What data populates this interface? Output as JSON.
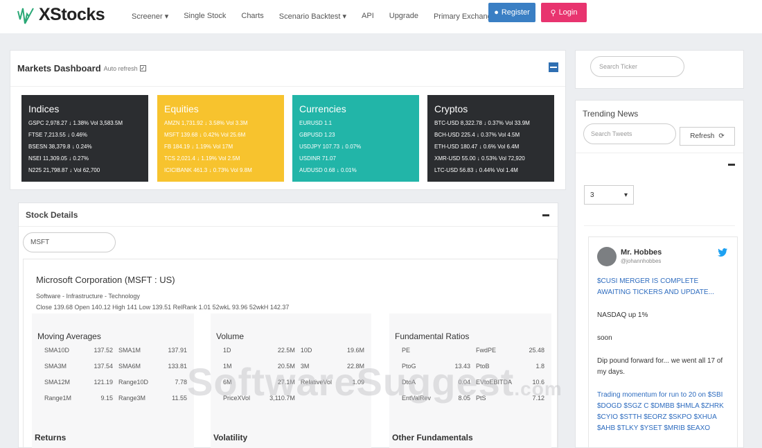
{
  "brand": {
    "name": "XStocks"
  },
  "nav": {
    "items": [
      "Screener ▾",
      "Single Stock",
      "Charts",
      "Scenario Backtest ▾",
      "API",
      "Upgrade",
      "Primary Exchange ▾ IN"
    ],
    "register_label": "Register",
    "login_label": "Login"
  },
  "markets": {
    "title": "Markets Dashboard",
    "auto_refresh_label": "Auto refresh",
    "tiles": [
      {
        "title": "Indices",
        "rows": [
          "GSPC 2,978.27 ↓ 1.38% Vol 3,583.5M",
          "FTSE 7,213.55 ↓ 0.46%",
          "BSESN 38,379.8 ↓ 0.24%",
          "NSEI 11,309.05 ↓ 0.27%",
          "N225 21,798.87 ↓ Vol 62,700"
        ]
      },
      {
        "title": "Equities",
        "rows": [
          "AMZN 1,731.92 ↓ 3.58% Vol 3.3M",
          "MSFT 139.68 ↓ 0.42% Vol 25.6M",
          "FB 184.19 ↓ 1.19% Vol 17M",
          "TCS 2,021.4 ↓ 1.19% Vol 2.5M",
          "ICICIBANK 461.3 ↓ 0.73% Vol 9.8M"
        ]
      },
      {
        "title": "Currencies",
        "rows": [
          "EURUSD 1.1",
          "GBPUSD 1.23",
          "USDJPY 107.73 ↓ 0.07%",
          "USDINR 71.07",
          "AUDUSD 0.68 ↓ 0.01%"
        ]
      },
      {
        "title": "Cryptos",
        "rows": [
          "BTC-USD 8,322.78 ↓ 0.37% Vol 33.9M",
          "BCH-USD 225.4 ↓ 0.37% Vol 4.5M",
          "ETH-USD 180.47 ↓ 0.6% Vol 6.4M",
          "XMR-USD 55.00 ↓ 0.53% Vol 72,920",
          "LTC-USD 56.83 ↓ 0.44% Vol 1.4M"
        ]
      }
    ]
  },
  "stock": {
    "title": "Stock Details",
    "ticker_value": "MSFT",
    "company_name": "Microsoft Corporation  (MSFT : US)",
    "sector": "Software - Infrastructure - Technology",
    "stats": "Close 139.68   Open 140.12   High 141   Low 139.51   RelRank 1.01   52wkL 93.96   52wkH 142.37",
    "moving_averages": {
      "title": "Moving Averages",
      "rows": [
        [
          "SMA10D",
          "137.52",
          "SMA1M",
          "137.91"
        ],
        [
          "SMA3M",
          "137.54",
          "SMA6M",
          "133.81"
        ],
        [
          "SMA12M",
          "121.19",
          "Range10D",
          "7.78"
        ],
        [
          "Range1M",
          "9.15",
          "Range3M",
          "11.55"
        ]
      ]
    },
    "volume": {
      "title": "Volume",
      "rows": [
        [
          "1D",
          "22.5M",
          "10D",
          "19.6M"
        ],
        [
          "1M",
          "20.5M",
          "3M",
          "22.8M"
        ],
        [
          "6M",
          "27.1M",
          "RelativeVol",
          "1.09"
        ],
        [
          "PriceXVol",
          "3,110.7M",
          "",
          ""
        ]
      ]
    },
    "fundamentals": {
      "title": "Fundamental Ratios",
      "rows": [
        [
          "PE",
          "",
          "FwdPE",
          "25.48"
        ],
        [
          "PtoG",
          "13.43",
          "PtoB",
          "1.8"
        ],
        [
          "DtoA",
          "0.04",
          "EVtoEBITDA",
          "10.6"
        ],
        [
          "EntValRev",
          "8.05",
          "PtS",
          "7.12"
        ]
      ]
    },
    "returns_label": "Returns",
    "volatility_label": "Volatility",
    "other_fundamentals_label": "Other Fundamentals"
  },
  "sidebar": {
    "search_ticker_placeholder": "Search Ticker",
    "trending_title": "Trending News",
    "search_tweets_placeholder": "Search Tweets",
    "refresh_label": "Refresh",
    "select_value": "3",
    "tweet": {
      "name": "Mr. Hobbes",
      "handle": "@johannhobbes",
      "paragraphs": [
        "$CUSI MERGER IS COMPLETE AWAITING TICKERS AND UPDATE...",
        "NASDAQ up 1%",
        "soon",
        "Dip pound forward for... we went all 17 of my days.",
        "Trading momentum for run to 20 on $SBI $DOGD $SGZ C $DMBB $HMLA $ZHRK $CYIO $STTH $EORZ $SKPO $XHUA $AHB $TLKY $YSET $MRIB $EAXO"
      ]
    }
  },
  "watermark": {
    "text": "SoftwareSuggest",
    "suffix": ".com"
  },
  "colors": {
    "register": "#3a7fc4",
    "login": "#e8346f",
    "indices": "#2b2d30",
    "equities": "#f7c32e",
    "currencies": "#22b5a8",
    "cryptos": "#2b2d30"
  }
}
